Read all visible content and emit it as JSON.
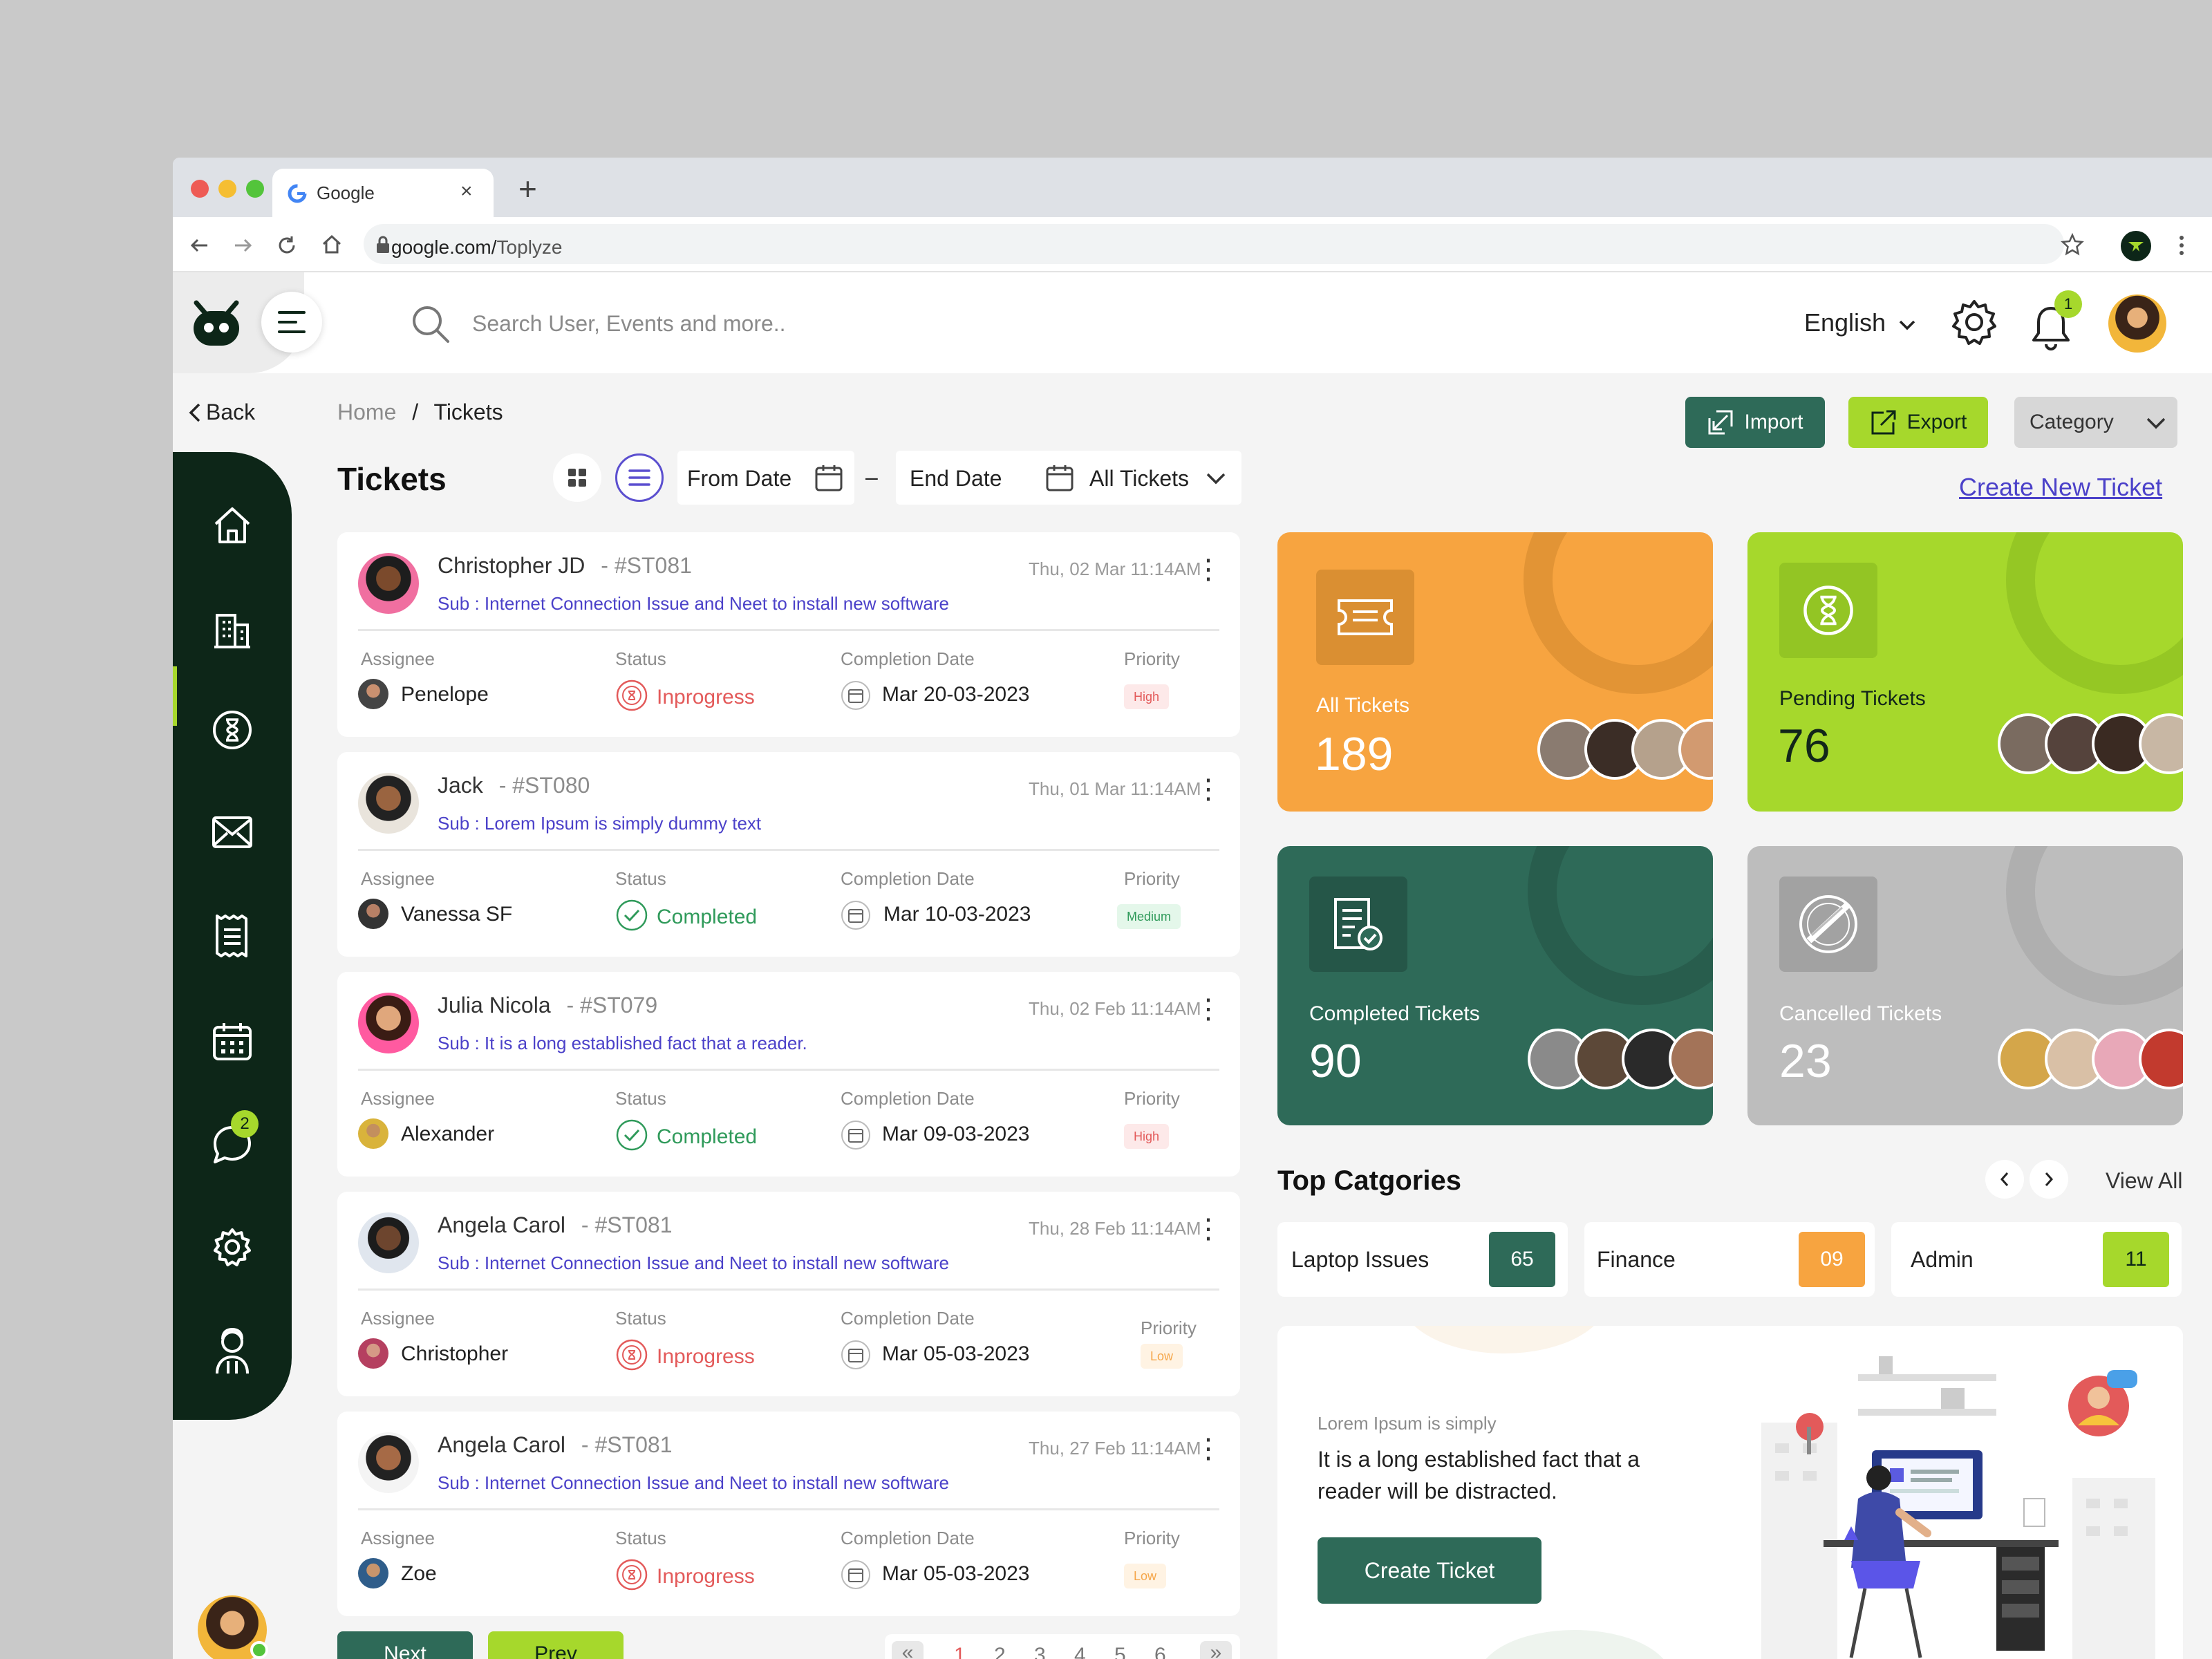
{
  "browser": {
    "tab_title": "Google",
    "url_host": "google.com/",
    "url_path": "Toplyze"
  },
  "topbar": {
    "search_placeholder": "Search User, Events and more..",
    "language": "English",
    "notification_count": "1"
  },
  "nav": {
    "back": "Back",
    "chat_badge": "2",
    "items": [
      "home-icon",
      "building-icon",
      "hourglass-icon",
      "mail-icon",
      "notes-icon",
      "calendar-icon",
      "chat-icon",
      "gear-icon",
      "user-support-icon"
    ]
  },
  "breadcrumb": {
    "home": "Home",
    "sep": "/",
    "current": "Tickets"
  },
  "page_title": "Tickets",
  "filters": {
    "from_date": "From Date",
    "dash": "–",
    "end_date": "End Date",
    "all_tickets": "All Tickets"
  },
  "actions": {
    "import": "Import",
    "export": "Export",
    "category": "Category",
    "create_new": "Create New Ticket"
  },
  "labels": {
    "assignee": "Assignee",
    "status": "Status",
    "completion": "Completion Date",
    "priority": "Priority"
  },
  "tickets": [
    {
      "name": "Christopher JD",
      "id": "- #ST081",
      "sub": "Sub : Internet Connection Issue and Neet to install new software",
      "date": "Thu, 02 Mar 11:14AM",
      "assignee": "Penelope",
      "status": "Inprogress",
      "completion": "Mar 20-03-2023",
      "priority": "High"
    },
    {
      "name": "Jack",
      "id": "- #ST080",
      "sub": "Sub : Lorem Ipsum is simply dummy text",
      "date": "Thu, 01 Mar 11:14AM",
      "assignee": "Vanessa SF",
      "status": "Completed",
      "completion": "Mar 10-03-2023",
      "priority": "Medium"
    },
    {
      "name": "Julia Nicola",
      "id": "- #ST079",
      "sub": "Sub : It is a long established fact that a reader.",
      "date": "Thu, 02 Feb 11:14AM",
      "assignee": "Alexander",
      "status": "Completed",
      "completion": "Mar 09-03-2023",
      "priority": "High"
    },
    {
      "name": "Angela Carol",
      "id": "- #ST081",
      "sub": "Sub : Internet Connection Issue and Neet to install new software",
      "date": "Thu, 28 Feb 11:14AM",
      "assignee": "Christopher",
      "status": "Inprogress",
      "completion": "Mar 05-03-2023",
      "priority": "Low"
    },
    {
      "name": "Angela Carol",
      "id": "- #ST081",
      "sub": "Sub : Internet Connection Issue and Neet to install new software",
      "date": "Thu, 27 Feb 11:14AM",
      "assignee": "Zoe",
      "status": "Inprogress",
      "completion": "Mar 05-03-2023",
      "priority": "Low"
    }
  ],
  "pagination": {
    "prev_btn": "Next",
    "next_btn": "Prev",
    "first": "«",
    "last": "»",
    "pages": [
      "1",
      "2",
      "3",
      "4",
      "5",
      "6"
    ]
  },
  "stats": {
    "all": {
      "label": "All Tickets",
      "value": "189"
    },
    "pending": {
      "label": "Pending Tickets",
      "value": "76"
    },
    "completed": {
      "label": "Completed Tickets",
      "value": "90"
    },
    "cancelled": {
      "label": "Cancelled Tickets",
      "value": "23"
    }
  },
  "categories": {
    "title": "Top Catgories",
    "view_all": "View All",
    "items": [
      {
        "name": "Laptop Issues",
        "count": "65"
      },
      {
        "name": "Finance",
        "count": "09"
      },
      {
        "name": "Admin",
        "count": "11"
      }
    ]
  },
  "promo": {
    "eyebrow": "Lorem Ipsum is simply",
    "body_line1": "It is a long established fact that a",
    "body_line2": "reader will be distracted.",
    "button": "Create Ticket"
  },
  "colors": {
    "sidebar": "#0d2618",
    "teal": "#2e6a58",
    "lime": "#a6d82c",
    "orange": "#f7a440",
    "grey": "#bdbdbd",
    "link": "#4b41c9"
  }
}
